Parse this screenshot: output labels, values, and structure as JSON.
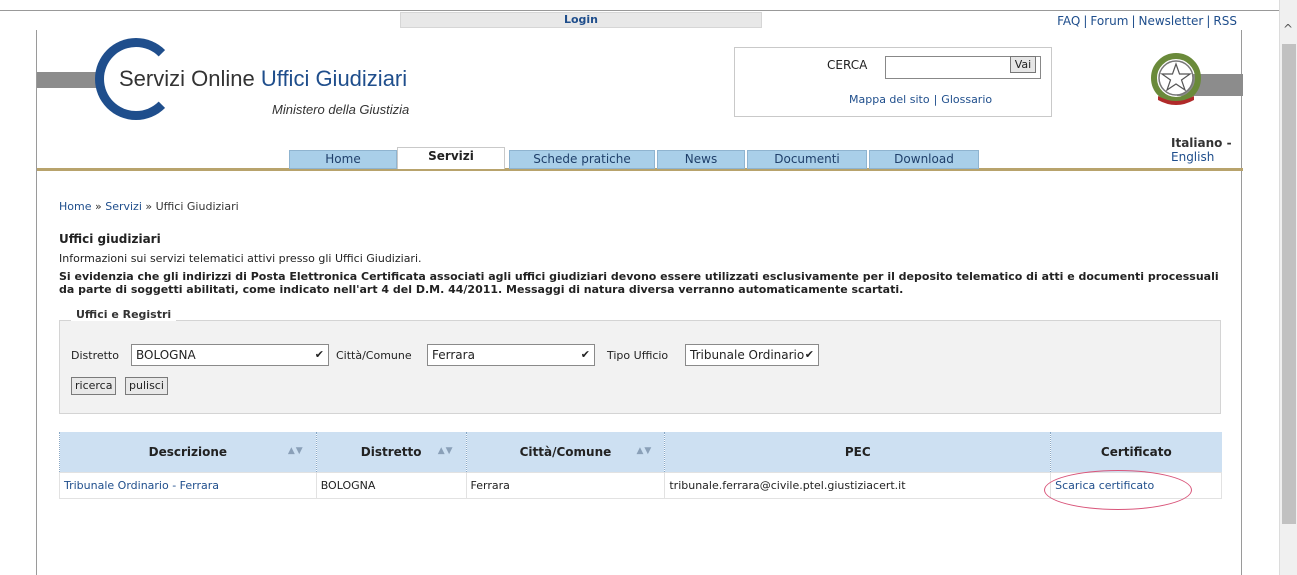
{
  "topbar": {
    "login": "Login",
    "links": [
      "FAQ",
      "Forum",
      "Newsletter",
      "RSS"
    ]
  },
  "header": {
    "logo_text_grey": "Servizi Online ",
    "logo_text_blue": "Uffici Giudiziari",
    "logo_sub": "Ministero della Giustizia",
    "search_label": "CERCA",
    "search_button": "Vai",
    "search_value": "",
    "site_links": [
      "Mappa del sito",
      "Glossario"
    ],
    "lang_current": "Italiano",
    "lang_sep": " - ",
    "lang_other": "English"
  },
  "nav": {
    "tabs": [
      "Home",
      "Servizi",
      "Schede pratiche",
      "News",
      "Documenti",
      "Download"
    ],
    "active": "Servizi"
  },
  "content": {
    "breadcrumb": [
      "Home",
      "Servizi",
      "Uffici Giudiziari"
    ],
    "breadcrumb_sep": " » ",
    "title": "Uffici giudiziari",
    "info": "Informazioni sui servizi telematici attivi presso gli Uffici Giudiziari.",
    "warning": "Si evidenzia che gli indirizzi di Posta Elettronica Certificata associati agli uffici giudiziari devono essere utilizzati esclusivamente per il deposito telematico di atti e documenti processuali da parte di soggetti abilitati, come indicato nell'art 4 del D.M. 44/2011. Messaggi di natura diversa verranno automaticamente scartati."
  },
  "form": {
    "legend": "Uffici e Registri",
    "distretto_label": "Distretto",
    "distretto_value": "BOLOGNA",
    "citta_label": "Città/Comune",
    "citta_value": "Ferrara",
    "tipo_label": "Tipo Ufficio",
    "tipo_value": "Tribunale Ordinario",
    "search_button": "ricerca",
    "clear_button": "pulisci"
  },
  "table": {
    "headers": [
      "Descrizione",
      "Distretto",
      "Città/Comune",
      "PEC",
      "Certificato"
    ],
    "sort_icon": "▲▼",
    "row": {
      "descrizione": "Tribunale Ordinario - Ferrara",
      "distretto": "BOLOGNA",
      "citta": "Ferrara",
      "pec": "tribunale.ferrara@civile.ptel.giustiziacert.it",
      "certificato": "Scarica certificato"
    }
  },
  "colors": {
    "brand_blue": "#1f4e8c",
    "tab_blue": "#a9cfe9",
    "header_blue": "#cde0f2",
    "highlight_circle": "#d9557a"
  }
}
